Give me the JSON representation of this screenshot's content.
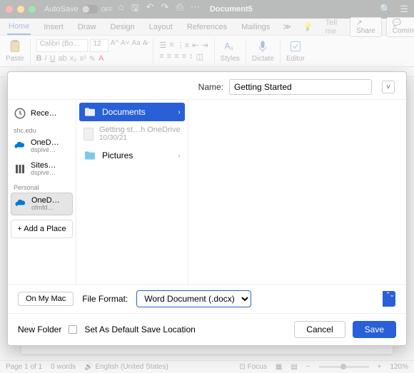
{
  "titlebar": {
    "autosave_label": "AutoSave",
    "autosave_state": "OFF",
    "document_title": "Document5"
  },
  "ribbon_tabs": {
    "items": [
      "Home",
      "Insert",
      "Draw",
      "Design",
      "Layout",
      "References",
      "Mailings"
    ],
    "tell_me": "Tell me",
    "share": "Share",
    "comments": "Comments"
  },
  "ribbon": {
    "paste_label": "Paste",
    "font_name": "Calibri (Bo…",
    "font_size": "12",
    "styles_label": "Styles",
    "dictate_label": "Dictate",
    "editor_label": "Editor"
  },
  "statusbar": {
    "page": "Page 1 of 1",
    "words": "0 words",
    "language": "English (United States)",
    "focus": "Focus",
    "zoom": "120%"
  },
  "dialog": {
    "name_label": "Name:",
    "name_value": "Getting Started",
    "sidebar": {
      "recent": "Rece…",
      "group1": "shc.edu",
      "onedrive1": {
        "label": "OneD…",
        "sub": "dspive…"
      },
      "sites": {
        "label": "Sites…",
        "sub": "dspive…"
      },
      "group2": "Personal",
      "onedrive2": {
        "label": "OneD…",
        "sub": "ofmfd…"
      },
      "add_place": "Add a Place"
    },
    "col1": {
      "documents": "Documents",
      "file": {
        "name": "Getting st…h OneDrive",
        "date": "10/30/21"
      },
      "pictures": "Pictures"
    },
    "on_my_mac": "On My Mac",
    "file_format_label": "File Format:",
    "file_format_value": "Word Document (.docx)",
    "new_folder": "New Folder",
    "default_loc": "Set As Default Save Location",
    "cancel": "Cancel",
    "save": "Save"
  }
}
